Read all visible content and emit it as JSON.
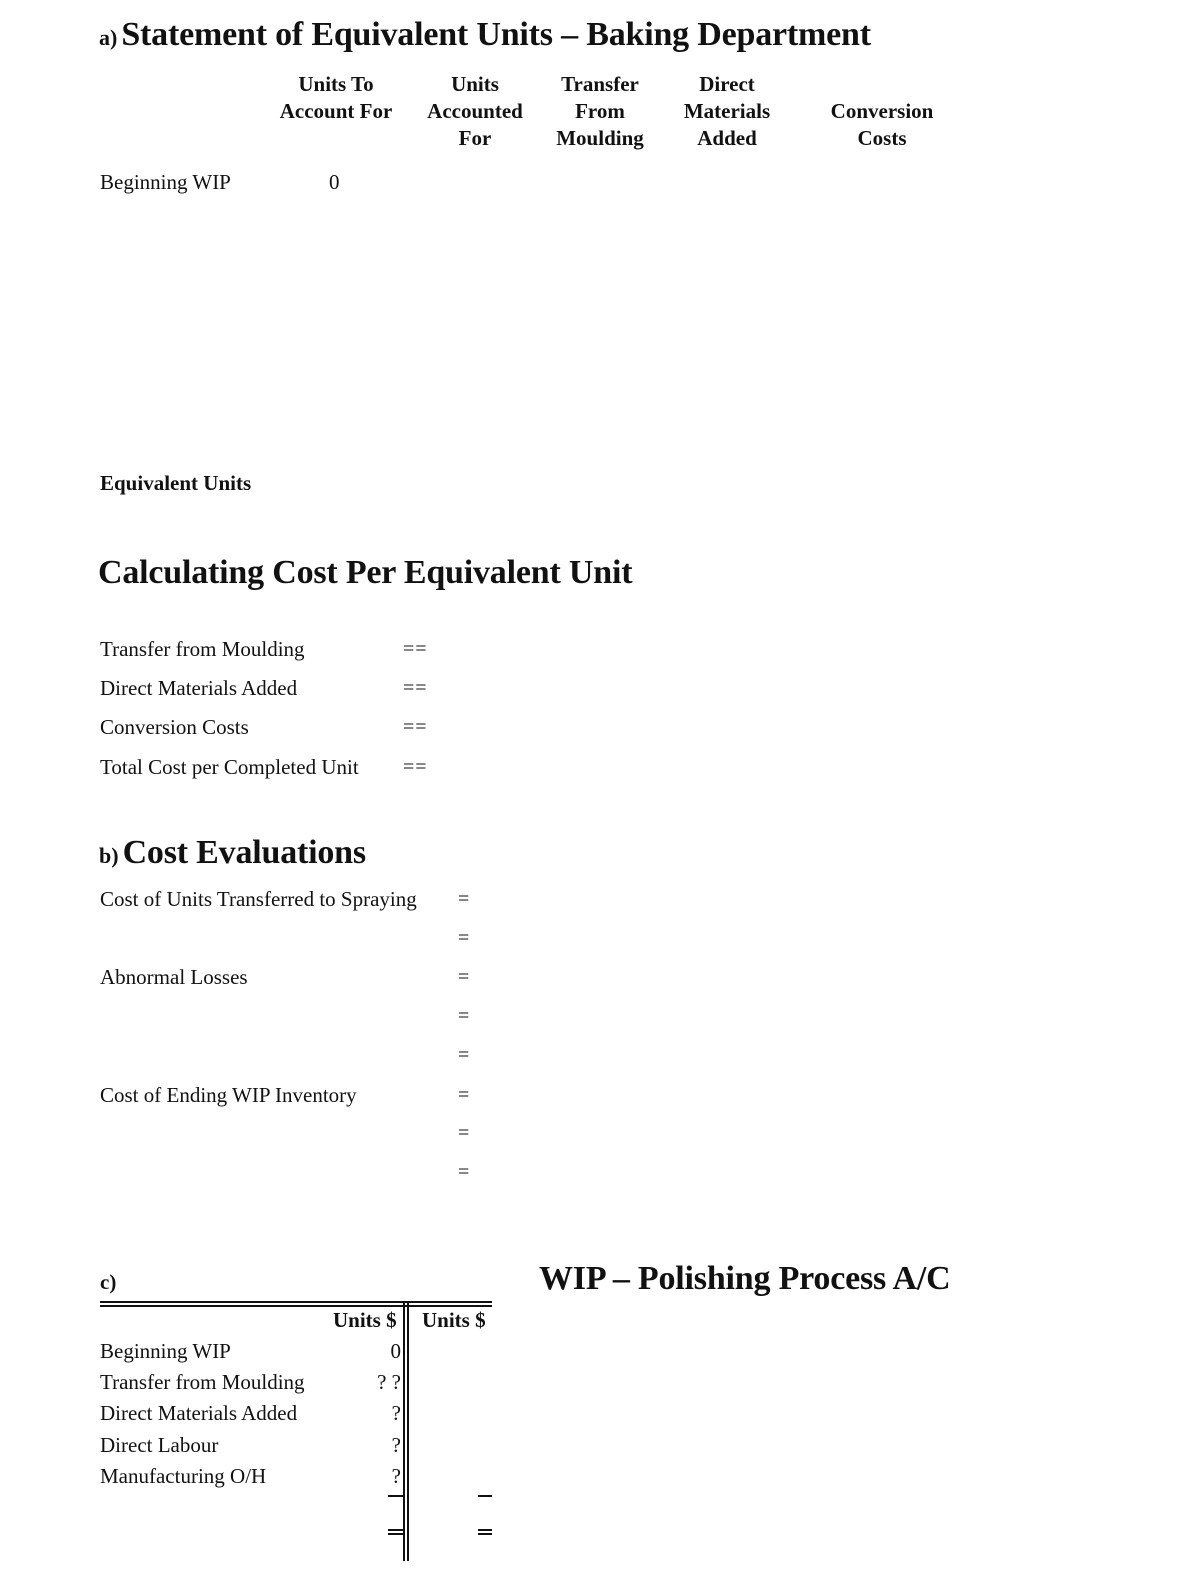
{
  "section_a": {
    "prefix": "a)",
    "title": "Statement of Equivalent Units – Baking Department",
    "columns": [
      {
        "line1": "Units To",
        "line2": "Account For",
        "line3": ""
      },
      {
        "line1": "Units",
        "line2": "Accounted",
        "line3": "For"
      },
      {
        "line1": "Transfer",
        "line2": "From",
        "line3": "Moulding"
      },
      {
        "line1": "Direct",
        "line2": "Materials",
        "line3": "Added"
      },
      {
        "line1": "",
        "line2": "Conversion",
        "line3": "Costs"
      }
    ],
    "rows": [
      {
        "label": "Beginning WIP",
        "units_to_account_for": "0"
      }
    ],
    "equivalent_units_label": "Equivalent Units"
  },
  "cost_per_unit": {
    "title": "Calculating Cost Per Equivalent Unit",
    "rows": [
      {
        "label": "Transfer from Moulding",
        "value": "=="
      },
      {
        "label": "Direct Materials Added",
        "value": "=="
      },
      {
        "label": "Conversion Costs",
        "value": "=="
      },
      {
        "label": "Total Cost per Completed Unit",
        "value": "=="
      }
    ]
  },
  "section_b": {
    "prefix": "b)",
    "title": "Cost Evaluations",
    "rows": [
      {
        "label": "Cost of Units Transferred to Spraying",
        "value": "="
      },
      {
        "label": "",
        "value": "="
      },
      {
        "label": "Abnormal Losses",
        "value": "="
      },
      {
        "label": "",
        "value": "="
      },
      {
        "label": "",
        "value": "="
      },
      {
        "label": "Cost of Ending WIP Inventory",
        "value": "="
      },
      {
        "label": "",
        "value": "="
      },
      {
        "label": "",
        "value": "="
      }
    ]
  },
  "section_c": {
    "prefix": "c)",
    "title": "WIP – Polishing Process A/C",
    "debit_header": "Units $",
    "credit_header": "Units $",
    "debit_rows": [
      {
        "label": "Beginning WIP",
        "value": "0"
      },
      {
        "label": "Transfer from Moulding",
        "value": "? ?"
      },
      {
        "label": "Direct Materials Added",
        "value": "?"
      },
      {
        "label": "Direct Labour",
        "value": "?"
      },
      {
        "label": "Manufacturing O/H",
        "value": "?"
      }
    ]
  }
}
